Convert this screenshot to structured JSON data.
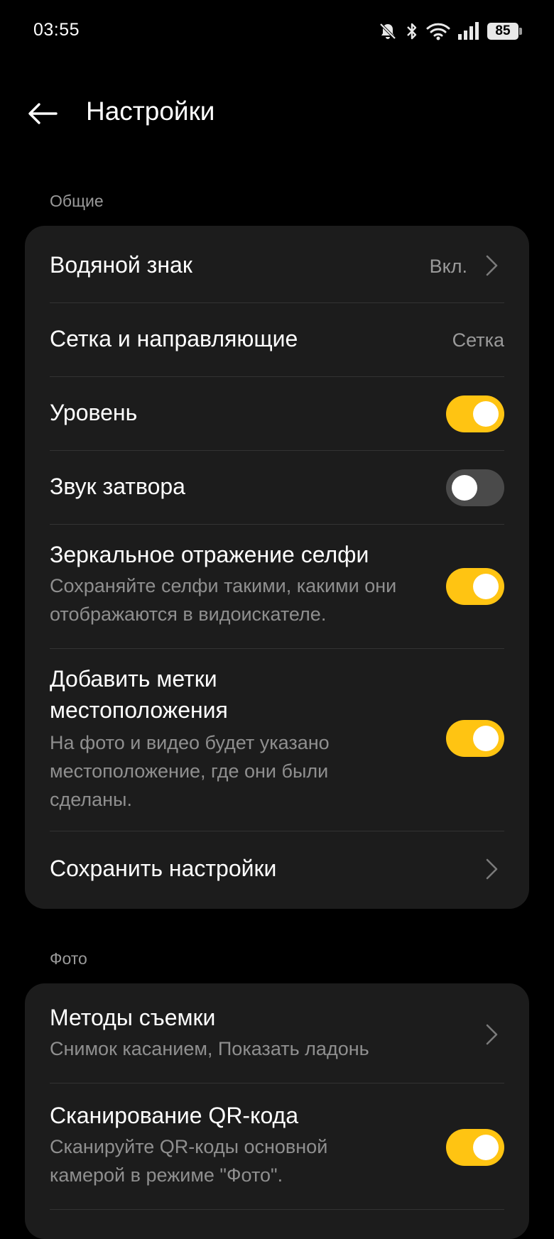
{
  "status_bar": {
    "time": "03:55",
    "battery": "85",
    "icons": [
      "bell-muted-icon",
      "bluetooth-icon",
      "wifi-icon",
      "signal-icon",
      "battery-icon"
    ]
  },
  "header": {
    "title": "Настройки",
    "back_icon": "back-arrow-icon"
  },
  "sections": {
    "general": {
      "label": "Общие",
      "items": [
        {
          "title": "Водяной знак",
          "value": "Вкл.",
          "type": "link"
        },
        {
          "title": "Сетка и направляющие",
          "value": "Сетка",
          "type": "value"
        },
        {
          "title": "Уровень",
          "type": "toggle",
          "on": true
        },
        {
          "title": "Звук затвора",
          "type": "toggle",
          "on": false
        },
        {
          "title": "Зеркальное отражение селфи",
          "subtitle": "Сохраняйте селфи такими, какими они отображаются в видоискателе.",
          "type": "toggle",
          "on": true
        },
        {
          "title_line1": "Добавить метки",
          "title_line2": "местоположения",
          "subtitle": "На фото и видео будет указано местоположение, где они были сделаны.",
          "type": "toggle",
          "on": true
        },
        {
          "title": "Сохранить настройки",
          "type": "link"
        }
      ]
    },
    "photo": {
      "label": "Фото",
      "items": [
        {
          "title": "Методы съемки",
          "subtitle": "Снимок касанием, Показать ладонь",
          "type": "link"
        },
        {
          "title": "Сканирование QR-кода",
          "subtitle": "Сканируйте QR-коды основной камерой в режиме \"Фото\".",
          "type": "toggle",
          "on": true
        }
      ]
    }
  },
  "colors": {
    "background": "#000000",
    "card": "#1c1c1c",
    "accent": "#ffc412",
    "toggle_off": "#4a4a4a",
    "secondary_text": "#8f8f8f"
  }
}
